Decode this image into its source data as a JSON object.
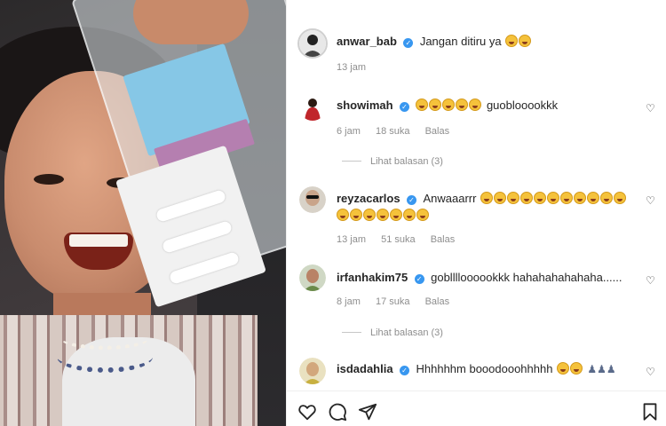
{
  "post": {
    "author": "anwar_bab",
    "caption": "Jangan ditiru ya",
    "time": "13 jam"
  },
  "comments": [
    {
      "username": "showimah",
      "text": "guoblooookkk",
      "time": "6 jam",
      "likes": "18 suka",
      "reply": "Balas",
      "view_replies": "Lihat balasan (3)"
    },
    {
      "username": "reyzacarlos",
      "text": "Anwaaarrr",
      "time": "13 jam",
      "likes": "51 suka",
      "reply": "Balas"
    },
    {
      "username": "irfanhakim75",
      "text": "goblllloooookkk hahahahahahaha......",
      "time": "8 jam",
      "likes": "17 suka",
      "reply": "Balas",
      "view_replies": "Lihat balasan (3)"
    },
    {
      "username": "isdadahlia",
      "text": "Hhhhhhm booodooohhhhh"
    }
  ],
  "colors": {
    "verified": "#3897f0",
    "meta_text": "#8e8e8e",
    "text": "#262626"
  },
  "icons": [
    "heart-icon",
    "comment-icon",
    "share-icon",
    "bookmark-icon"
  ]
}
